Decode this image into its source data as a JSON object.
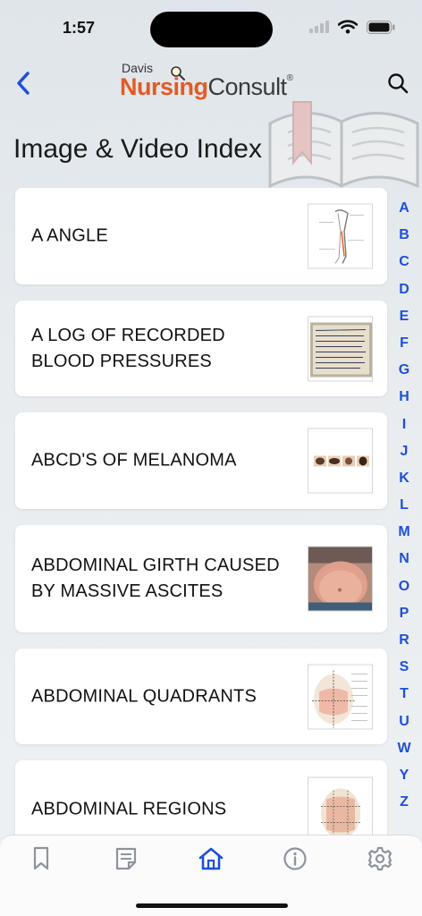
{
  "status_bar": {
    "time": "1:57"
  },
  "header": {
    "logo_small": "Davis",
    "logo_primary": "Nursing",
    "logo_secondary": "Consult",
    "logo_mark": "®"
  },
  "page": {
    "title": "Image & Video Index"
  },
  "items": [
    {
      "label": "A ANGLE",
      "thumb": "skeleton-leg-diagram"
    },
    {
      "label": "A LOG OF RECORDED BLOOD PRESSURES",
      "thumb": "handwritten-log-photo"
    },
    {
      "label": "ABCD'S OF MELANOMA",
      "thumb": "melanoma-samples"
    },
    {
      "label": "ABDOMINAL GIRTH CAUSED BY MASSIVE ASCITES",
      "thumb": "abdomen-photo"
    },
    {
      "label": "ABDOMINAL QUADRANTS",
      "thumb": "quadrant-diagram"
    },
    {
      "label": "ABDOMINAL REGIONS",
      "thumb": "regions-diagram"
    }
  ],
  "alpha_index": [
    "A",
    "B",
    "C",
    "D",
    "E",
    "F",
    "G",
    "H",
    "I",
    "J",
    "K",
    "L",
    "M",
    "N",
    "O",
    "P",
    "R",
    "S",
    "T",
    "U",
    "W",
    "Y",
    "Z"
  ],
  "tabs": [
    {
      "name": "bookmark-icon",
      "active": false
    },
    {
      "name": "notes-icon",
      "active": false
    },
    {
      "name": "home-icon",
      "active": true
    },
    {
      "name": "info-icon",
      "active": false
    },
    {
      "name": "settings-icon",
      "active": false
    }
  ],
  "colors": {
    "accent": "#1e4fd8",
    "brand_orange": "#e35a24",
    "tab_inactive": "#8e949c"
  }
}
